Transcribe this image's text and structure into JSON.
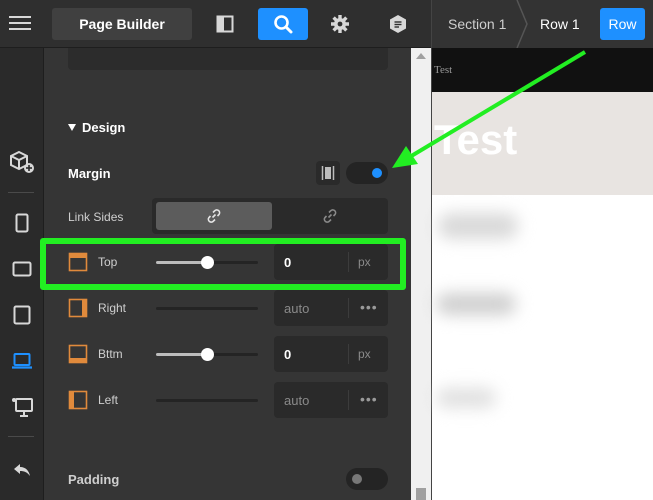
{
  "topbar": {
    "page_builder_label": "Page Builder",
    "breadcrumbs": [
      {
        "label": "Section 1"
      },
      {
        "label": "Row 1"
      }
    ],
    "row_button_label": "Row"
  },
  "panel": {
    "design_heading": "Design",
    "margin_label": "Margin",
    "margin_toggle_on": true,
    "link_sides_label": "Link Sides",
    "sides": [
      {
        "label": "Top",
        "value": "0",
        "unit": "px",
        "slider_fraction": 0.5,
        "active": true
      },
      {
        "label": "Right",
        "value": "auto",
        "unit": "•••",
        "active": false
      },
      {
        "label": "Bttm",
        "value": "0",
        "unit": "px",
        "slider_fraction": 0.5,
        "active": true
      },
      {
        "label": "Left",
        "value": "auto",
        "unit": "•••",
        "active": false
      }
    ],
    "padding_label": "Padding",
    "padding_toggle_on": false
  },
  "preview": {
    "strip_text": "Test",
    "hero_title": "Test"
  },
  "colors": {
    "accent": "#1e90ff",
    "annotation": "#22ee22",
    "side_icon": "#e08a3c"
  },
  "icons": [
    "hamburger-icon",
    "layout-panel-icon",
    "search-icon",
    "gear-icon",
    "hex-doc-icon",
    "cube-add-icon",
    "phone-icon",
    "tablet-landscape-icon",
    "tablet-icon",
    "laptop-icon",
    "desktop-icon",
    "undo-icon",
    "link-icon",
    "unlink-icon",
    "vertical-spacing-icon"
  ]
}
